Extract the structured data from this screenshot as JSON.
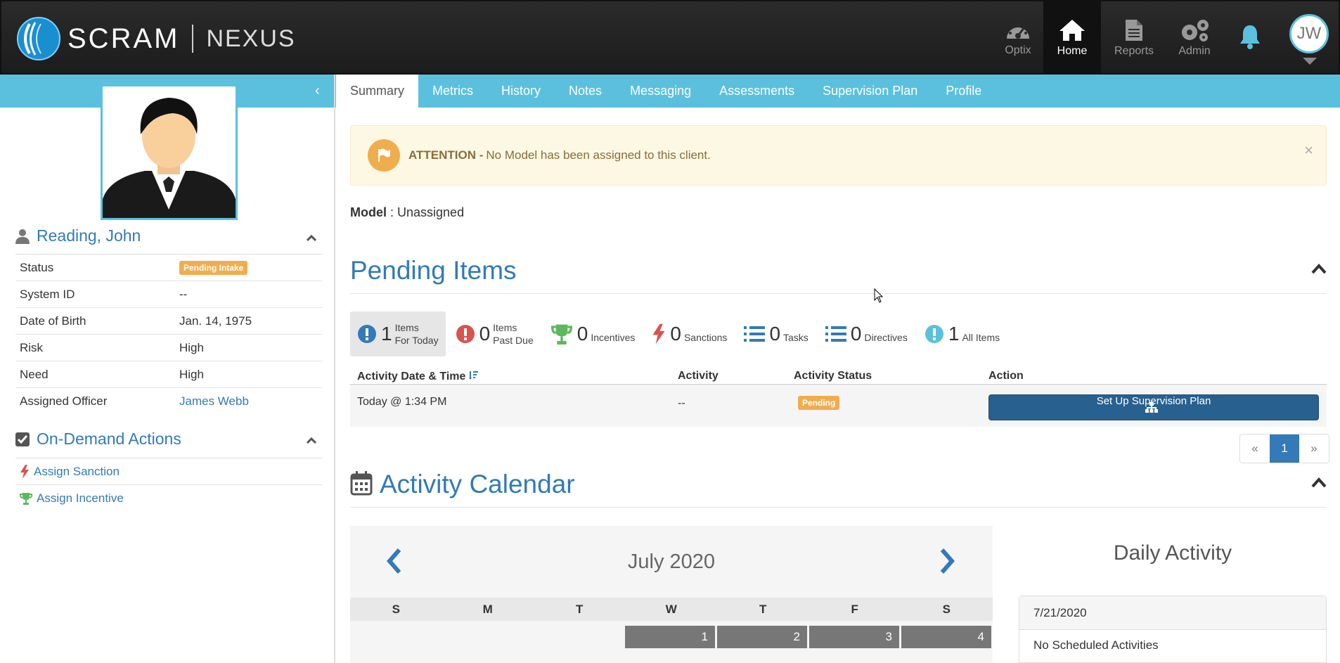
{
  "brand": {
    "name": "SCRAM",
    "product": "NEXUS"
  },
  "topnav": {
    "items": [
      {
        "label": "Optix",
        "icon": "gauge-icon"
      },
      {
        "label": "Home",
        "icon": "home-icon"
      },
      {
        "label": "Reports",
        "icon": "document-icon"
      },
      {
        "label": "Admin",
        "icon": "gears-icon"
      }
    ],
    "user_initials": "JW"
  },
  "tabs": [
    "Summary",
    "Metrics",
    "History",
    "Notes",
    "Messaging",
    "Assessments",
    "Supervision Plan",
    "Profile"
  ],
  "client": {
    "name": "Reading, John",
    "fields": [
      {
        "label": "Status",
        "value": "Pending Intake"
      },
      {
        "label": "System ID",
        "value": "--"
      },
      {
        "label": "Date of Birth",
        "value": "Jan. 14, 1975"
      },
      {
        "label": "Risk",
        "value": "High"
      },
      {
        "label": "Need",
        "value": "High"
      },
      {
        "label": "Assigned Officer",
        "value": "James Webb"
      }
    ]
  },
  "on_demand": {
    "title": "On-Demand Actions",
    "items": [
      "Assign Sanction",
      "Assign Incentive"
    ]
  },
  "alert": {
    "strong": "ATTENTION -",
    "text": "No Model has been assigned to this client.",
    "close": "×"
  },
  "model": {
    "label": "Model",
    "sep": " : ",
    "value": "Unassigned"
  },
  "pending": {
    "title": "Pending Items",
    "counters": [
      {
        "count": "1",
        "line1": "Items",
        "line2": "For Today"
      },
      {
        "count": "0",
        "line1": "Items",
        "line2": "Past Due"
      },
      {
        "count": "0",
        "label": "Incentives"
      },
      {
        "count": "0",
        "label": "Sanctions"
      },
      {
        "count": "0",
        "label": "Tasks"
      },
      {
        "count": "0",
        "label": "Directives"
      },
      {
        "count": "1",
        "label": "All Items"
      }
    ],
    "columns": [
      "Activity Date & Time",
      "Activity",
      "Activity Status",
      "Action"
    ],
    "rows": [
      {
        "datetime": "Today @ 1:34 PM",
        "activity": "--",
        "status": "Pending",
        "action": "Set Up Supervision Plan"
      }
    ],
    "pager": {
      "prev": "«",
      "current": "1",
      "next": "»"
    }
  },
  "calendar": {
    "title": "Activity Calendar",
    "month": "July 2020",
    "days": [
      "S",
      "M",
      "T",
      "W",
      "T",
      "F",
      "S"
    ],
    "first_week": [
      "1",
      "2",
      "3",
      "4"
    ]
  },
  "daily": {
    "title": "Daily Activity",
    "date": "7/21/2020",
    "empty": "No Scheduled Activities"
  },
  "colors": {
    "accent": "#5bc0de",
    "link": "#337ab7",
    "primary_button": "#286090",
    "warning": "#f0ad4e"
  }
}
